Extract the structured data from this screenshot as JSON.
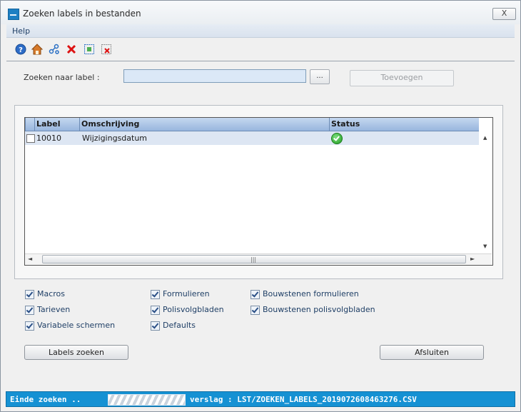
{
  "window": {
    "title": "Zoeken labels in bestanden",
    "close_label": "X"
  },
  "menu": {
    "help_label": "Help"
  },
  "toolbar": {
    "icons": [
      "help-icon",
      "home-icon",
      "share-icon",
      "delete-icon",
      "select-all-icon",
      "clear-selection-icon"
    ]
  },
  "search": {
    "label": "Zoeken naar label :",
    "value": "",
    "browse_label": "...",
    "add_label": "Toevoegen"
  },
  "grid": {
    "columns": [
      "Label",
      "Omschrijving",
      "Status"
    ],
    "rows": [
      {
        "checked": false,
        "label": "10010",
        "omschrijving": "Wijzigingsdatum",
        "status": "ok"
      }
    ]
  },
  "options": {
    "macros": "Macros",
    "tarieven": "Tarieven",
    "variabele_schermen": "Variabele schermen",
    "formulieren": "Formulieren",
    "polisvolgbladen": "Polisvolgbladen",
    "defaults": "Defaults",
    "bouwstenen_formulieren": "Bouwstenen formulieren",
    "bouwstenen_polisvolgbladen": "Bouwstenen polisvolgbladen"
  },
  "buttons": {
    "search_labels": "Labels zoeken",
    "close": "Afsluiten"
  },
  "status": {
    "left_text": "Einde zoeken ..",
    "report_text": "verslag : LST/ZOEKEN_LABELS_2019072608463276.CSV"
  },
  "colors": {
    "status_bar": "#1591d3",
    "grid_header": "#98b6de",
    "selected_row": "#dde6f3"
  }
}
